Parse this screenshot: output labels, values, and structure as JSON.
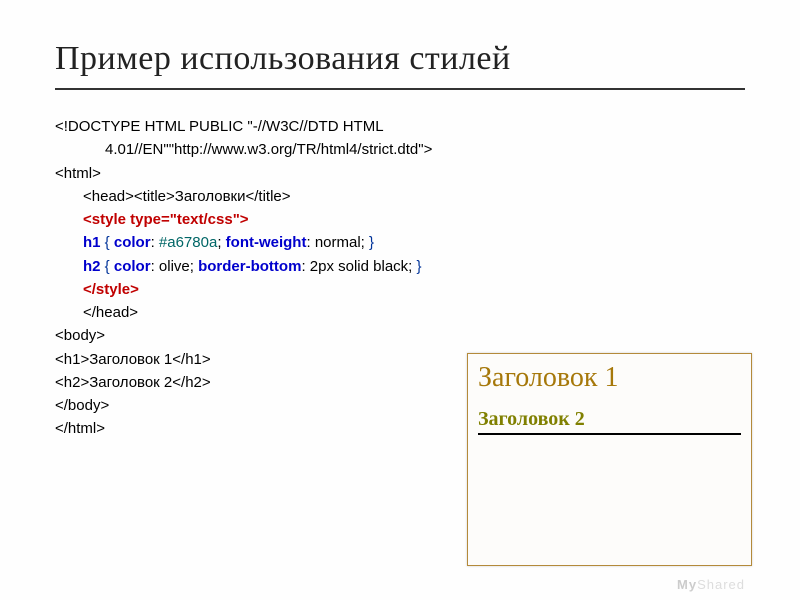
{
  "title": "Пример использования стилей",
  "code": {
    "doctype1": "<!DOCTYPE HTML PUBLIC \"-//W3C//DTD HTML",
    "doctype2": "4.01//EN\"\"http://www.w3.org/TR/html4/strict.dtd\">",
    "html_open": "<html>",
    "head_title_open": "<head><title>",
    "title_text": "Заголовки",
    "title_close": "</title>",
    "style_open": "<style type=\"text/css\">",
    "h1_sel": "h1",
    "brace_open1": " { ",
    "color_prop1": "color",
    "color_sep1": ": ",
    "color_val1": "#a6780a",
    "sep1": "; ",
    "fw_prop": "font-weight",
    "fw_sep": ": ",
    "fw_val": "normal;",
    "brace_close1": " }",
    "h2_sel": "h2",
    "brace_open2": " { ",
    "color_prop2": "color",
    "color_sep2": ": ",
    "color_val2": "olive",
    "sep2": "; ",
    "bb_prop": "border-bottom",
    "bb_sep": ": ",
    "bb_val": "2px solid black;",
    "brace_close2": " }",
    "style_close": "</style>",
    "head_close": "</head>",
    "body_open": "<body>",
    "h1_open": "<h1>",
    "h1_text": "Заголовок 1",
    "h1_close": "</h1>",
    "h2_open": "<h2>",
    "h2_text": "Заголовок 2",
    "h2_close": "</h2>",
    "body_close": "</body>",
    "html_close": "</html>"
  },
  "preview": {
    "h1": "Заголовок 1",
    "h2": "Заголовок 2"
  },
  "watermark": {
    "my": "My",
    "shared": "Shared"
  }
}
